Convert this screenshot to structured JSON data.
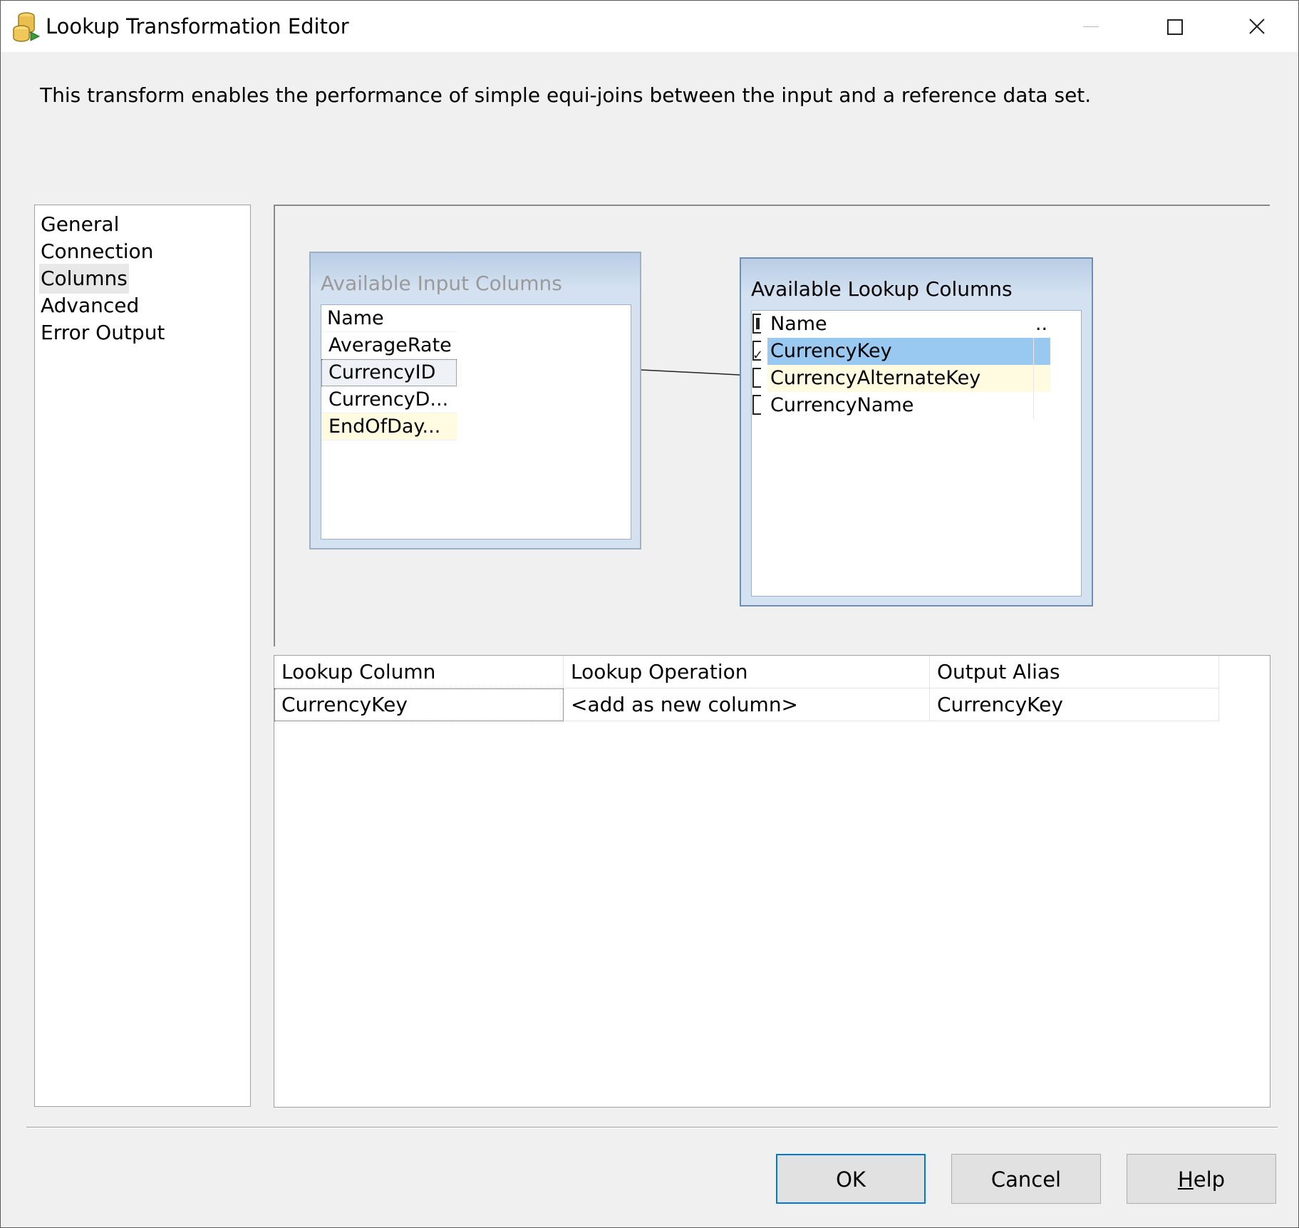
{
  "window": {
    "title": "Lookup Transformation Editor",
    "icon": "lookup-transform-icon",
    "controls": [
      "minimize-icon",
      "maximize-icon",
      "close-icon"
    ]
  },
  "description": "This transform enables the performance of simple equi-joins between the input and a reference data set.",
  "nav": {
    "selected": "Columns",
    "items": [
      {
        "label": "General"
      },
      {
        "label": "Connection"
      },
      {
        "label": "Columns"
      },
      {
        "label": "Advanced"
      },
      {
        "label": "Error Output"
      }
    ]
  },
  "input_columns": {
    "title": "Available Input Columns",
    "header": "Name",
    "rows": [
      {
        "label": "AverageRate"
      },
      {
        "label": "CurrencyID"
      },
      {
        "label": "CurrencyD..."
      },
      {
        "label": "EndOfDay..."
      }
    ]
  },
  "lookup_columns": {
    "title": "Available Lookup Columns",
    "header": "Name",
    "header_extra": "..",
    "rows": [
      {
        "label": "CurrencyKey",
        "checked": true,
        "selected": true
      },
      {
        "label": "CurrencyAlternateKey",
        "checked": false,
        "selected": false
      },
      {
        "label": "CurrencyName",
        "checked": false,
        "selected": false
      }
    ]
  },
  "mapping": {
    "from": "CurrencyID",
    "to": "CurrencyAlternateKey"
  },
  "grid": {
    "headers": {
      "lookup_column": "Lookup Column",
      "lookup_operation": "Lookup Operation",
      "output_alias": "Output Alias"
    },
    "rows": [
      {
        "lookup_column": "CurrencyKey",
        "lookup_operation": "<add as new column>",
        "output_alias": "CurrencyKey"
      }
    ]
  },
  "buttons": {
    "ok": "OK",
    "cancel": "Cancel",
    "help_mnemonic": "H",
    "help_rest": "elp"
  },
  "colors": {
    "selection": "#99c8f1",
    "hover_highlight": "#fffbe0",
    "default_button_border": "#0078d7"
  }
}
